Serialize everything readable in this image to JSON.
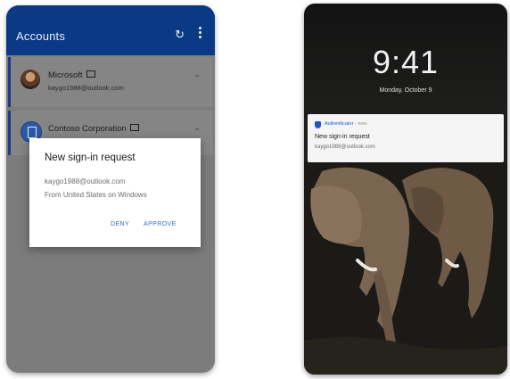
{
  "left_phone": {
    "appbar": {
      "title": "Accounts",
      "refresh_icon": "refresh-icon",
      "more_icon": "more-vert-icon"
    },
    "accounts": [
      {
        "name": "Microsoft",
        "email": "kaygo1988@outlook.com"
      },
      {
        "name": "Contoso Corporation",
        "email": ""
      }
    ],
    "dialog": {
      "title": "New sign-in request",
      "email": "kaygo1988@outlook.com",
      "from": "From United States on Windows",
      "deny_label": "DENY",
      "approve_label": "APPROVE"
    }
  },
  "right_phone": {
    "lock_screen": {
      "time": "9:41",
      "date": "Monday, October 9"
    },
    "notification": {
      "app": "Authenticator",
      "separator": "·",
      "time": "now",
      "title": "New sign-in request",
      "body": "kaygo1988@outlook.com"
    }
  },
  "colors": {
    "appbar": "#0a3a86",
    "dialog_action": "#2b6bd0",
    "overlay": "#7c7c7c",
    "lock_background": "#131313",
    "notification_accent": "#1d56c6"
  }
}
